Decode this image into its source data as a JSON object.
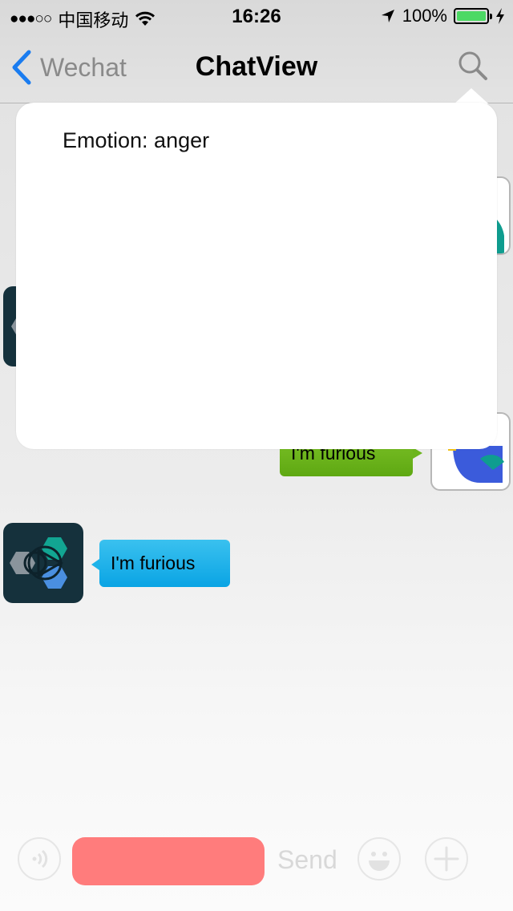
{
  "status_bar": {
    "signal": "●●●○○",
    "carrier": "中国移动",
    "time": "16:26",
    "battery": "100%"
  },
  "nav": {
    "back_label": "Wechat",
    "title": "ChatView",
    "accent_color": "#1a7cf0"
  },
  "popover": {
    "text": "Emotion: anger"
  },
  "messages": [
    {
      "side": "right",
      "text": "I'm furious",
      "color": "#6cb51c"
    },
    {
      "side": "left",
      "text": "I'm furious",
      "color": "#1db3ea"
    }
  ],
  "toolbar": {
    "voice_icon": "voice-icon",
    "record_color": "#ff7c7c",
    "send_label": "Send",
    "emoji_icon": "smiley-icon",
    "add_icon": "plus-icon"
  }
}
